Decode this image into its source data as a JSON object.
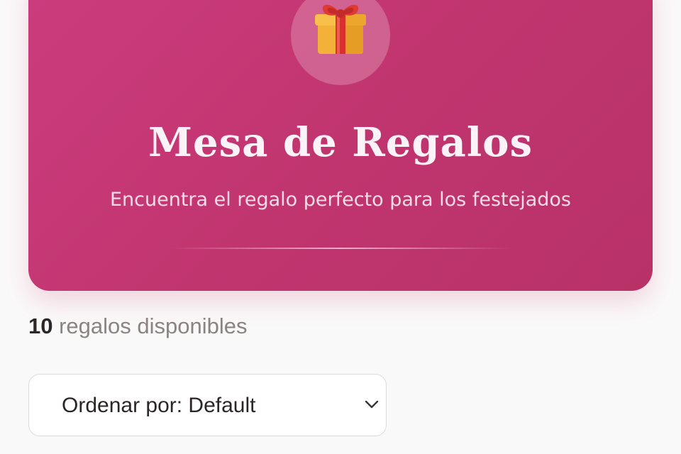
{
  "hero": {
    "title": "Mesa de Regalos",
    "subtitle": "Encuentra el regalo perfecto para los festejados",
    "icon": "gift-icon",
    "accent_color": "#c1356f"
  },
  "summary": {
    "count": "10",
    "label": "regalos disponibles"
  },
  "sort": {
    "label": "Ordenar por: Default",
    "icon": "chevron-down-icon"
  }
}
